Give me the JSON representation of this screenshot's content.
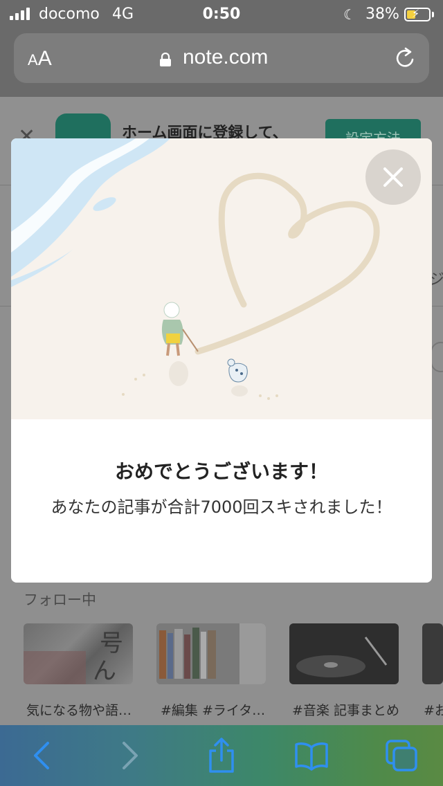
{
  "status_bar": {
    "carrier": "docomo",
    "network": "4G",
    "time": "0:50",
    "battery": "38%"
  },
  "browser": {
    "text_size_small": "A",
    "text_size_big": "A",
    "url": "note.com"
  },
  "banner": {
    "text": "ホーム画面に登録して、",
    "button_label": "設定方法"
  },
  "following": {
    "label": "フォロー中",
    "items": [
      {
        "title": "気になる物や語…"
      },
      {
        "title": "#編集 #ライタ…"
      },
      {
        "title": "#音楽 記事まとめ"
      },
      {
        "title": "#お"
      }
    ]
  },
  "modal": {
    "title": "おめでとうございます！",
    "message": "あなたの記事が合計7000回スキされました！"
  },
  "icons": {
    "back": "chevron-left-icon",
    "forward": "chevron-right-icon",
    "share": "share-icon",
    "bookmarks": "book-icon",
    "tabs": "tabs-icon"
  },
  "colors": {
    "toolbar_icon": "#1a73e8",
    "brand_green": "#1f6f5e"
  }
}
